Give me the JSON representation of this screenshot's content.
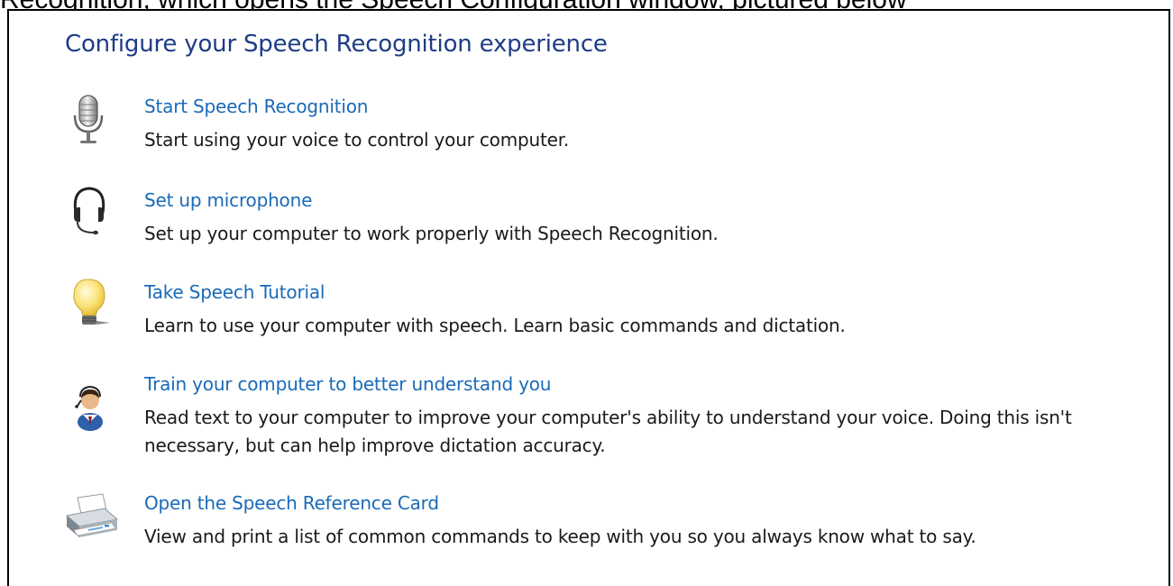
{
  "caption": "Recognition, which opens the Speech Configuration window, pictured below",
  "page": {
    "title": "Configure your Speech Recognition experience"
  },
  "tasks": [
    {
      "icon": "microphone-icon",
      "link": "Start Speech Recognition",
      "description": "Start using your voice to control your computer."
    },
    {
      "icon": "headset-icon",
      "link": "Set up microphone",
      "description": "Set up your computer to work properly with Speech Recognition."
    },
    {
      "icon": "lightbulb-icon",
      "link": "Take Speech Tutorial",
      "description": "Learn to use your computer with speech.  Learn basic commands and dictation."
    },
    {
      "icon": "user-speaking-icon",
      "link": "Train your computer to better understand you",
      "description": "Read text to your computer to improve your computer's ability to understand your voice.  Doing this isn't necessary, but can help improve dictation accuracy."
    },
    {
      "icon": "printer-icon",
      "link": "Open the Speech Reference Card",
      "description": "View and print a list of common commands to keep with you so you always know what to say."
    }
  ],
  "colors": {
    "title": "#1e3c87",
    "link": "#1a6ab8",
    "text": "#1a1a1a"
  }
}
